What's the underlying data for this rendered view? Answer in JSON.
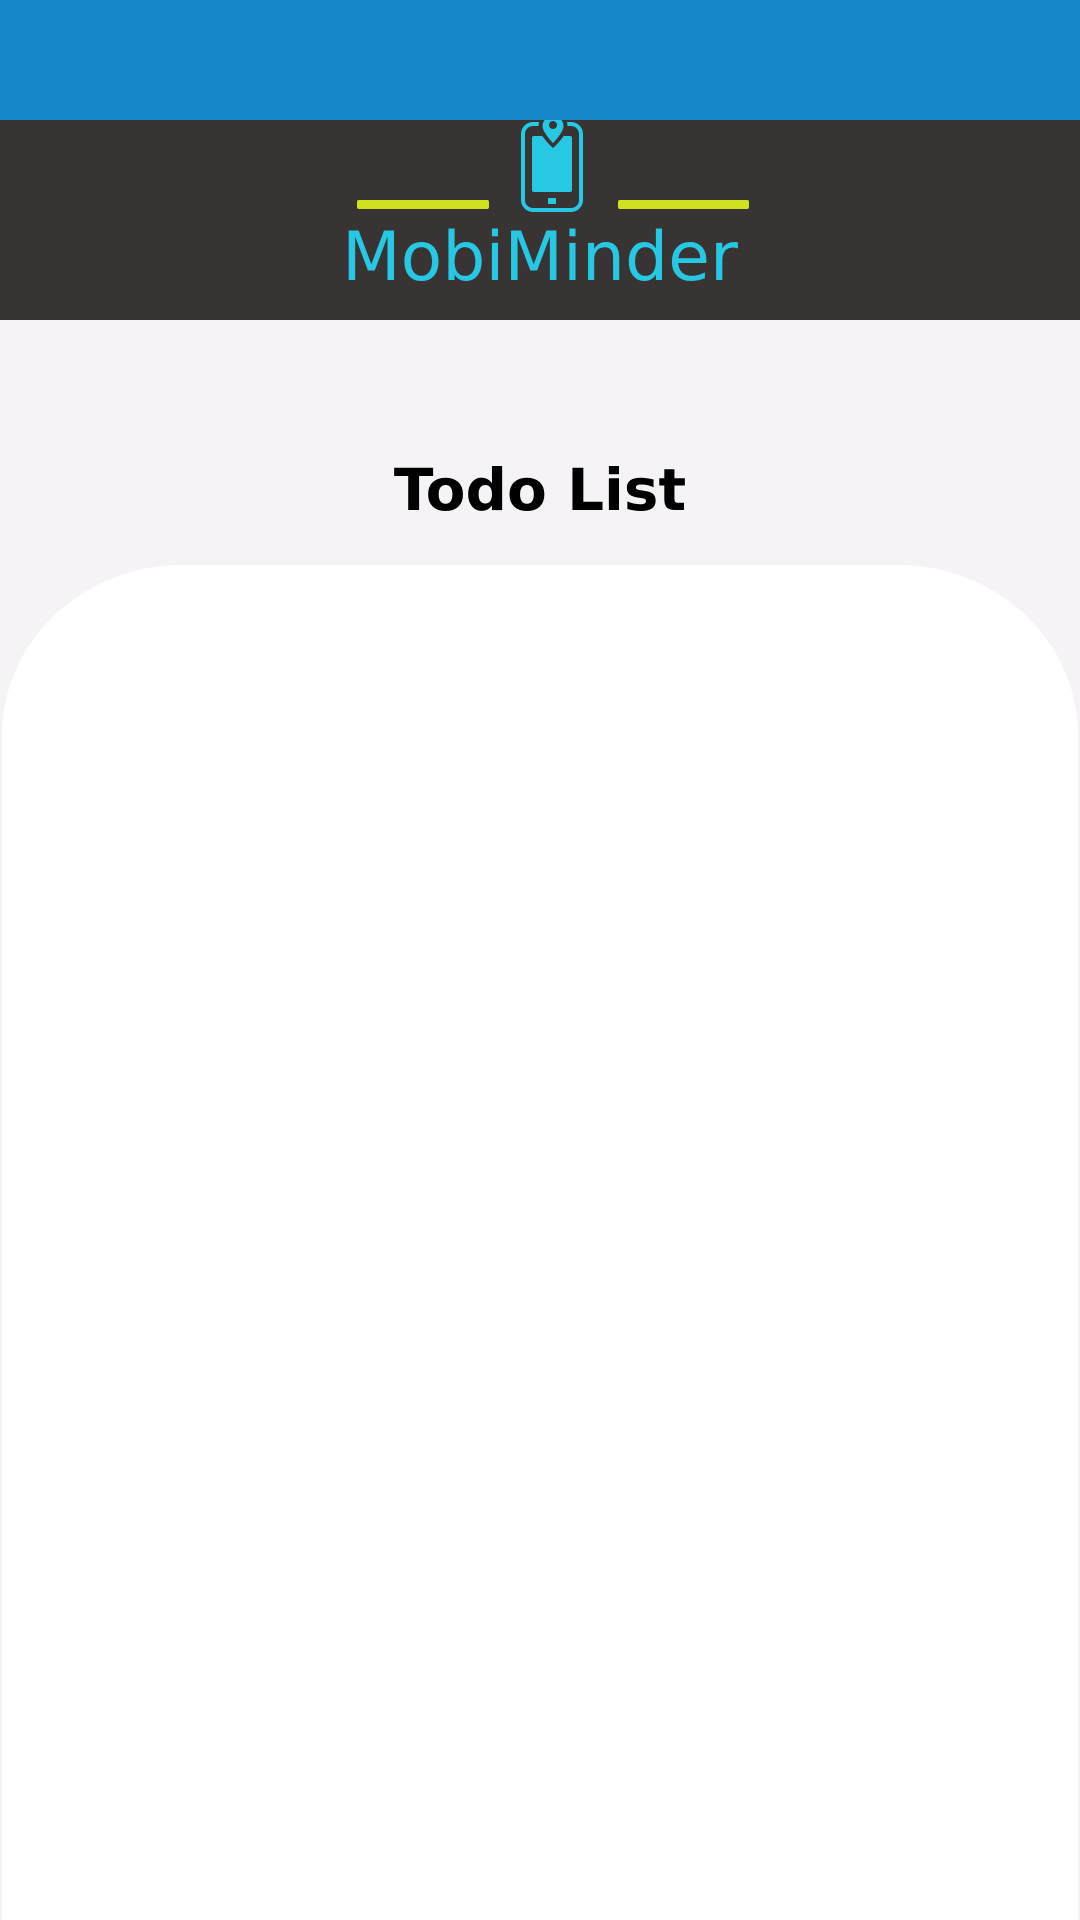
{
  "status_bar": {
    "color": "#1687c8"
  },
  "header": {
    "background": "#383434",
    "brand_name": "MobiMinder",
    "brand_color": "#26c8e4",
    "accent_line_color": "#cfe11f",
    "logo_icon": "phone-location-icon"
  },
  "main": {
    "title": "Todo List",
    "list_items": []
  }
}
